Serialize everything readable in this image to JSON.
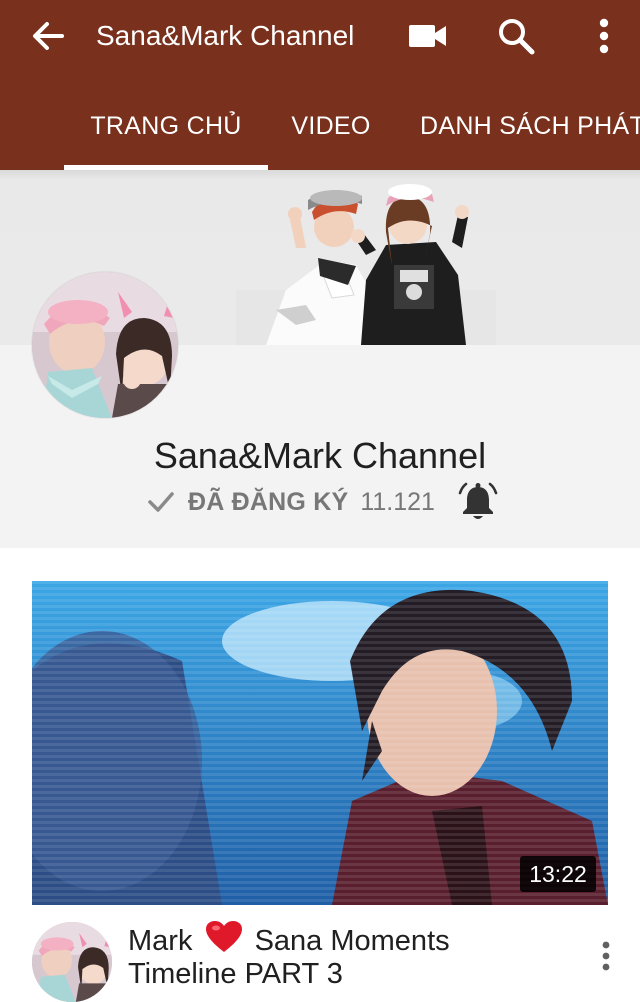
{
  "appbar": {
    "title": "Sana&Mark Channel",
    "back_icon": "arrow-back-icon",
    "camera_icon": "video-camera-icon",
    "search_icon": "search-icon",
    "more_icon": "more-vert-icon",
    "background": "#79301c"
  },
  "tabs": [
    {
      "label": "TRANG CHỦ",
      "active": true
    },
    {
      "label": "VIDEO",
      "active": false
    },
    {
      "label": "DANH SÁCH PHÁT",
      "active": false
    }
  ],
  "channel": {
    "name": "Sana&Mark Channel",
    "subscribed_label": "ĐÃ ĐĂNG KÝ",
    "subscriber_count": "11.121",
    "check_icon": "check-icon",
    "bell_icon": "notification-bell-icon"
  },
  "video": {
    "duration": "13:22",
    "title_line1_a": "Mark",
    "title_heart_icon": "red-heart-icon",
    "title_line1_b": "Sana Moments",
    "title_line2": "Timeline PART 3",
    "menu_icon": "more-vert-icon"
  }
}
